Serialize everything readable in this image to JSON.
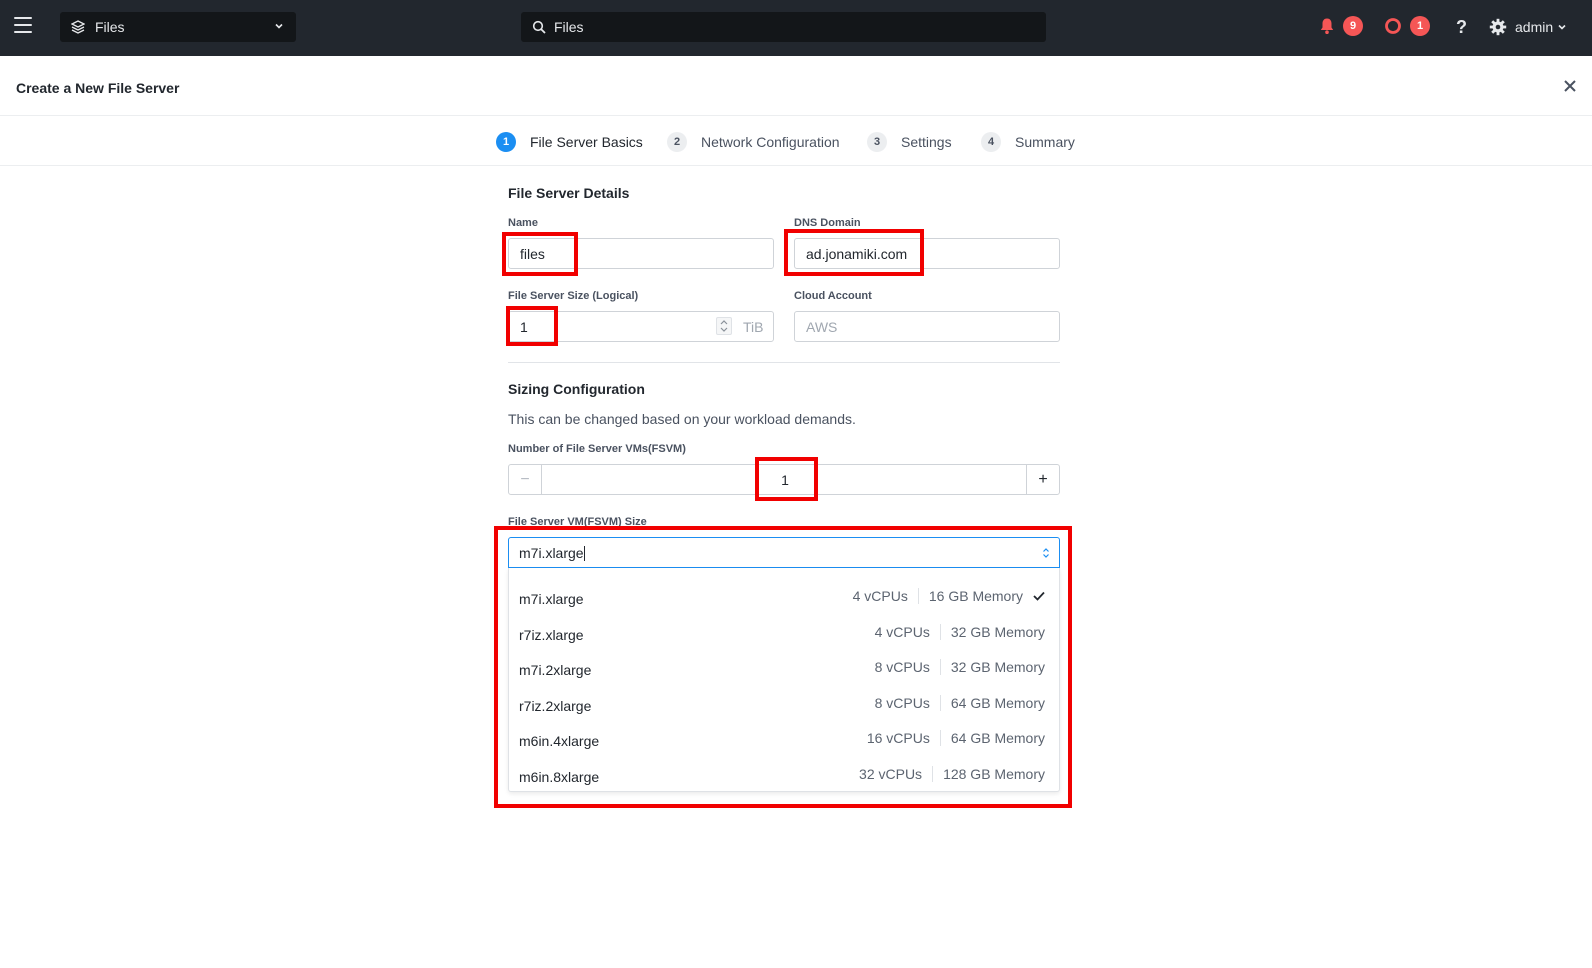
{
  "topbar": {
    "app_name": "Files",
    "search_value": "Files",
    "alerts_count": "9",
    "tasks_count": "1",
    "user": "admin"
  },
  "header": {
    "title": "Create a New File Server"
  },
  "steps": [
    {
      "num": "1",
      "label": "File Server Basics"
    },
    {
      "num": "2",
      "label": "Network Configuration"
    },
    {
      "num": "3",
      "label": "Settings"
    },
    {
      "num": "4",
      "label": "Summary"
    }
  ],
  "details": {
    "title": "File Server Details",
    "name_label": "Name",
    "name_value": "files",
    "dns_label": "DNS Domain",
    "dns_value": "ad.jonamiki.com",
    "size_label": "File Server Size (Logical)",
    "size_value": "1",
    "size_unit": "TiB",
    "cloud_label": "Cloud Account",
    "cloud_value": "AWS"
  },
  "sizing": {
    "title": "Sizing Configuration",
    "helper": "This can be changed based on your workload demands.",
    "fsvm_count_label": "Number of File Server VMs(FSVM)",
    "fsvm_count": "1",
    "fsvm_size_label": "File Server VM(FSVM) Size",
    "fsvm_size_value": "m7i.xlarge",
    "options": [
      {
        "name": "m7i.xlarge",
        "cpus": "4 vCPUs",
        "memory": "16 GB Memory",
        "selected": true
      },
      {
        "name": "r7iz.xlarge",
        "cpus": "4 vCPUs",
        "memory": "32 GB Memory",
        "selected": false
      },
      {
        "name": "m7i.2xlarge",
        "cpus": "8 vCPUs",
        "memory": "32 GB Memory",
        "selected": false
      },
      {
        "name": "r7iz.2xlarge",
        "cpus": "8 vCPUs",
        "memory": "64 GB Memory",
        "selected": false
      },
      {
        "name": "m6in.4xlarge",
        "cpus": "16 vCPUs",
        "memory": "64 GB Memory",
        "selected": false
      },
      {
        "name": "m6in.8xlarge",
        "cpus": "32 vCPUs",
        "memory": "128 GB Memory",
        "selected": false
      }
    ]
  },
  "colors": {
    "topbar": "#22272e",
    "accent": "#1b8ef2",
    "badge": "#f55656",
    "annotation": "#f10000"
  }
}
